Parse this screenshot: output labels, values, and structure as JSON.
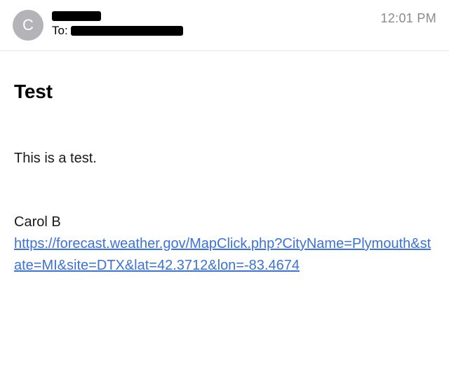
{
  "header": {
    "avatar_initial": "C",
    "to_label": "To:",
    "timestamp": "12:01 PM"
  },
  "message": {
    "subject": "Test",
    "body_line": "This is a test.",
    "signature_name": "Carol B",
    "link_text": "https://forecast.weather.gov/MapClick.php?CityName=Plymouth&state=MI&site=DTX&lat=42.3712&lon=-83.4674"
  }
}
